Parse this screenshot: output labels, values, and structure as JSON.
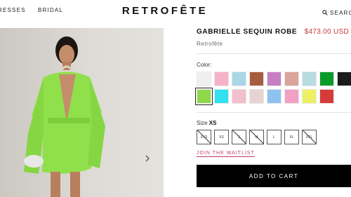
{
  "header": {
    "nav": [
      {
        "label": "RESSES"
      },
      {
        "label": "BRIDAL"
      }
    ],
    "logo": "RETROFÊTE",
    "search_label": "SEARCH",
    "search_icon": "search-icon"
  },
  "product": {
    "title": "GABRIELLE SEQUIN ROBE",
    "price": "$473.00 USD",
    "brand": "Retrofête",
    "image_next_icon": "chevron-right-icon"
  },
  "color": {
    "label": "Color:",
    "swatches": [
      {
        "color": "#eef0f2"
      },
      {
        "color": "#f5b3c7"
      },
      {
        "color": "#a9d7e6"
      },
      {
        "color": "#a55d3f"
      },
      {
        "color": "#c67fc2"
      },
      {
        "color": "#d9a49a"
      },
      {
        "color": "#b8dbe0"
      },
      {
        "color": "#0a9a2a"
      },
      {
        "color": "#1b1b1b"
      },
      {
        "color": "#8fd84a"
      },
      {
        "color": "#33e1f0"
      },
      {
        "color": "#f1c0cc"
      },
      {
        "color": "#e8d3d3"
      },
      {
        "color": "#8ec3f0"
      },
      {
        "color": "#f2a1c4"
      },
      {
        "color": "#eef064"
      },
      {
        "color": "#d63a3a"
      }
    ],
    "selected_index": 9
  },
  "size": {
    "label": "Size",
    "selected": "XS",
    "options": [
      {
        "label": "XXS",
        "available": false
      },
      {
        "label": "XS",
        "available": true
      },
      {
        "label": "S",
        "available": false
      },
      {
        "label": "M",
        "available": false
      },
      {
        "label": "L",
        "available": true
      },
      {
        "label": "XL",
        "available": true
      },
      {
        "label": "XXL",
        "available": false
      }
    ]
  },
  "waitlist_label": "JOIN THE WAITLIST",
  "cart_label": "ADD TO CART"
}
